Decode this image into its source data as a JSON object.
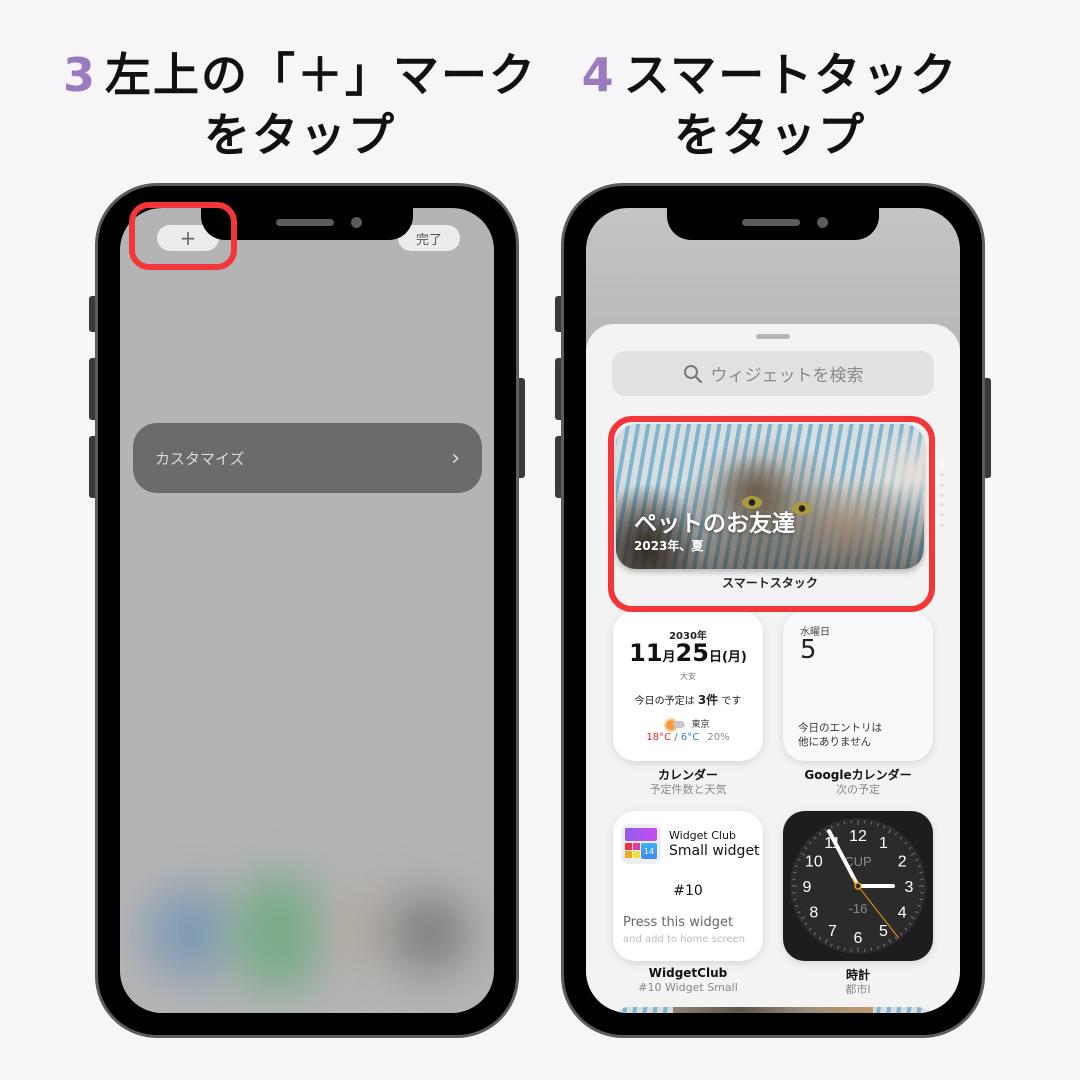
{
  "steps": [
    {
      "number": "3",
      "title_line1": "左上の「＋」マーク",
      "title_line2": "をタップ"
    },
    {
      "number": "4",
      "title_line1": "スマートタック",
      "title_line2": "をタップ"
    }
  ],
  "colors": {
    "step_number": "#9a7bbd",
    "highlight_ring": "#f2363a"
  },
  "left_screen": {
    "plus_button": "+",
    "done_button": "完了",
    "customize_label": "カスタマイズ",
    "customize_chevron": "›"
  },
  "right_screen": {
    "search_placeholder": "ウィジェットを検索",
    "smart_stack": {
      "photo_title": "ペットのお友達",
      "photo_subtitle": "2023年、夏",
      "label": "スマートスタック",
      "page_count": 7,
      "active_page": 1
    },
    "widgets": {
      "calendar": {
        "year": "2030年",
        "month": "11",
        "month_unit": "月",
        "day": "25",
        "day_unit": "日",
        "weekday": "(月)",
        "rokuyo": "大安",
        "schedule_prefix": "今日の予定は",
        "schedule_count": "3件",
        "schedule_suffix": "です",
        "city": "東京",
        "high": "18°C",
        "low": "6°C",
        "precip": "20%",
        "label": "カレンダー",
        "sublabel": "予定件数と天気"
      },
      "google_calendar": {
        "weekday": "水曜日",
        "day": "5",
        "message_line1": "今日のエントリは",
        "message_line2": "他にありません",
        "label": "Googleカレンダー",
        "sublabel": "次の予定"
      },
      "widget_club": {
        "brand": "Widget Club",
        "name": "Small widget",
        "icon_badge": "14",
        "number": "#10",
        "press": "Press this widget",
        "add": "and add to home screen",
        "label": "WidgetClub",
        "sublabel": "#10 Widget Small"
      },
      "clock": {
        "city_code": "CUP",
        "offset": "-16",
        "numerals": [
          "12",
          "1",
          "2",
          "3",
          "4",
          "5",
          "6",
          "7",
          "8",
          "9",
          "10",
          "11"
        ],
        "time_hour": 2,
        "time_minute": 55,
        "time_second": 22,
        "label": "時計",
        "sublabel": "都市I"
      }
    }
  }
}
